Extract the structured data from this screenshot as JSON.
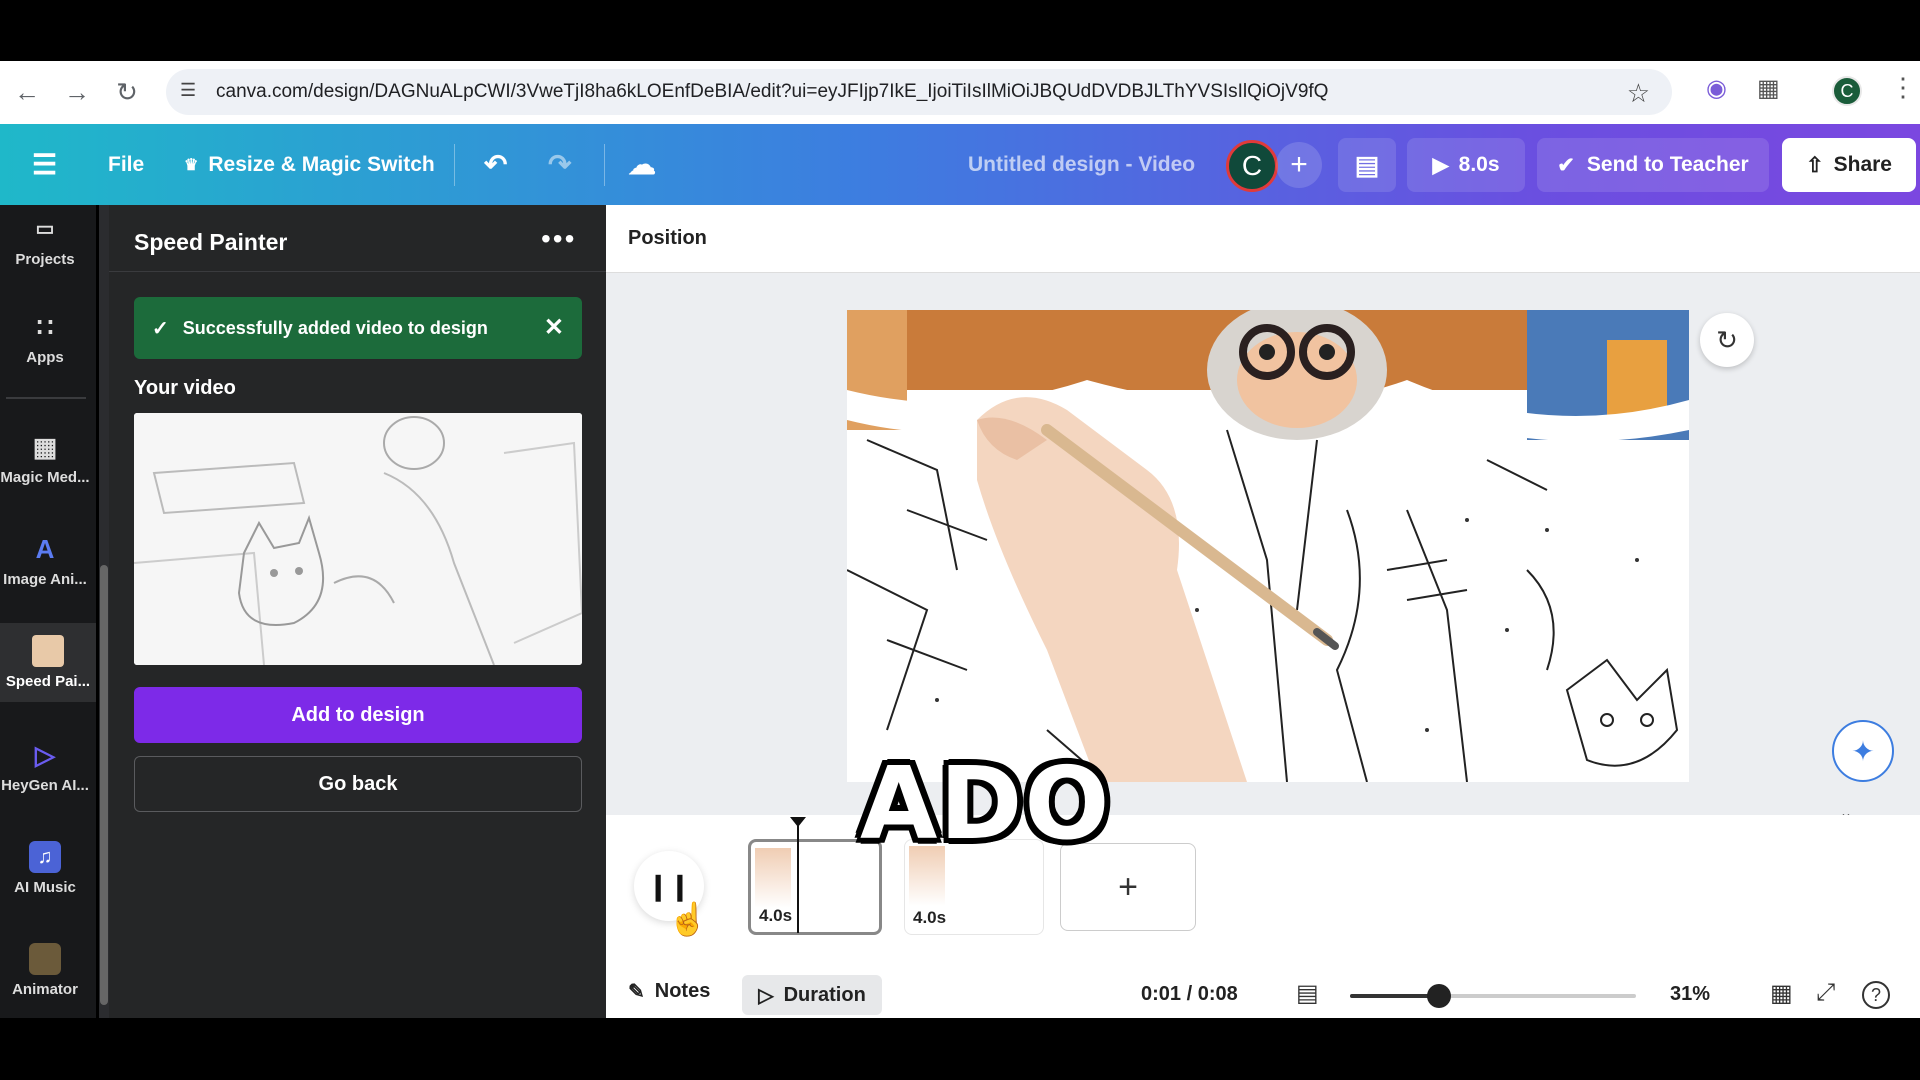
{
  "browser": {
    "url": "canva.com/design/DAGNuALpCWI/3VweTjI8ha6kLOEnfDeBIA/edit?ui=eyJFIjp7IkE_IjoiTiIsIlMiOiJBQUdDVDBJLThYVSIsIlQiOjV9fQ",
    "profile_initial": "C"
  },
  "header": {
    "file_label": "File",
    "resize_label": "Resize & Magic Switch",
    "title": "Untitled design - Video",
    "avatar_initial": "C",
    "play_duration": "8.0s",
    "send_label": "Send to Teacher",
    "share_label": "Share"
  },
  "rail": {
    "items": [
      {
        "label": "Projects",
        "icon": "folder-icon"
      },
      {
        "label": "Apps",
        "icon": "apps-grid-icon"
      },
      {
        "label": "Magic Med...",
        "icon": "magic-media-icon"
      },
      {
        "label": "Image Ani...",
        "icon": "image-animate-icon"
      },
      {
        "label": "Speed Pai...",
        "icon": "speed-painter-icon"
      },
      {
        "label": "HeyGen AI...",
        "icon": "heygen-icon"
      },
      {
        "label": "AI Music",
        "icon": "music-icon"
      },
      {
        "label": "Animator",
        "icon": "animator-icon"
      }
    ]
  },
  "panel": {
    "title": "Speed Painter",
    "toast": "Successfully added video to design",
    "section": "Your video",
    "add_label": "Add to design",
    "back_label": "Go back"
  },
  "toolbar": {
    "position_label": "Position"
  },
  "overlay": {
    "caption": "ADO"
  },
  "timeline": {
    "clips": [
      {
        "duration": "4.0s",
        "active": true
      },
      {
        "duration": "4.0s",
        "active": false
      }
    ]
  },
  "footer": {
    "notes_label": "Notes",
    "duration_label": "Duration",
    "time": "0:01 / 0:08",
    "zoom": "31%",
    "zoom_fraction": 0.31
  },
  "colors": {
    "header_start": "#1fb8c9",
    "header_end": "#7b47e0",
    "add_button": "#7d2ae8",
    "toast": "#1c6b3b"
  }
}
